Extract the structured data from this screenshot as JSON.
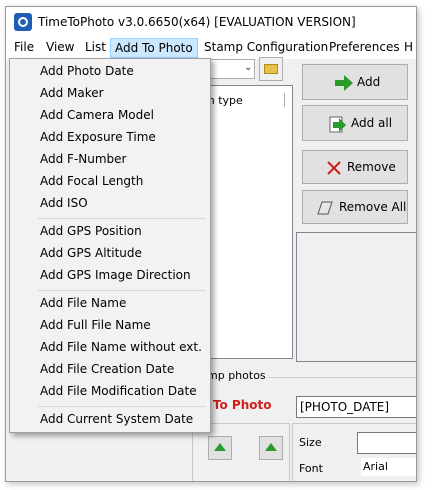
{
  "window": {
    "title": "TimeToPhoto v3.0.6650(x64) [EVALUATION VERSION]"
  },
  "menubar": {
    "items": [
      "File",
      "View",
      "List",
      "Add To Photo",
      "Stamp Configuration",
      "Preferences",
      "H"
    ]
  },
  "dropdown": {
    "items": [
      "Add Photo Date",
      "Add Maker",
      "Add Camera Model",
      "Add Exposure Time",
      "Add F-Number",
      "Add Focal Length",
      "Add ISO",
      "Add GPS Position",
      "Add GPS Altitude",
      "Add GPS Image Direction",
      "Add File Name",
      "Add Full File Name",
      "Add File Name without ext.",
      "Add File Creation Date",
      "Add File Modification Date",
      "Add Current System Date"
    ]
  },
  "filelist": {
    "column_header": "m type"
  },
  "buttons": {
    "add": "Add",
    "add_all": "Add all",
    "remove": "Remove",
    "remove_all": "Remove All"
  },
  "stamp": {
    "group_title": "mp photos",
    "preview": "t To Photo",
    "text_value": "[PHOTO_DATE]",
    "size_label": "Size",
    "font_label": "Font",
    "font_value": "Arial"
  },
  "colors": {
    "menu_highlight": "#cce8ff",
    "stamp_preview": "#d0201b",
    "add_arrow": "#2a9b2a"
  }
}
